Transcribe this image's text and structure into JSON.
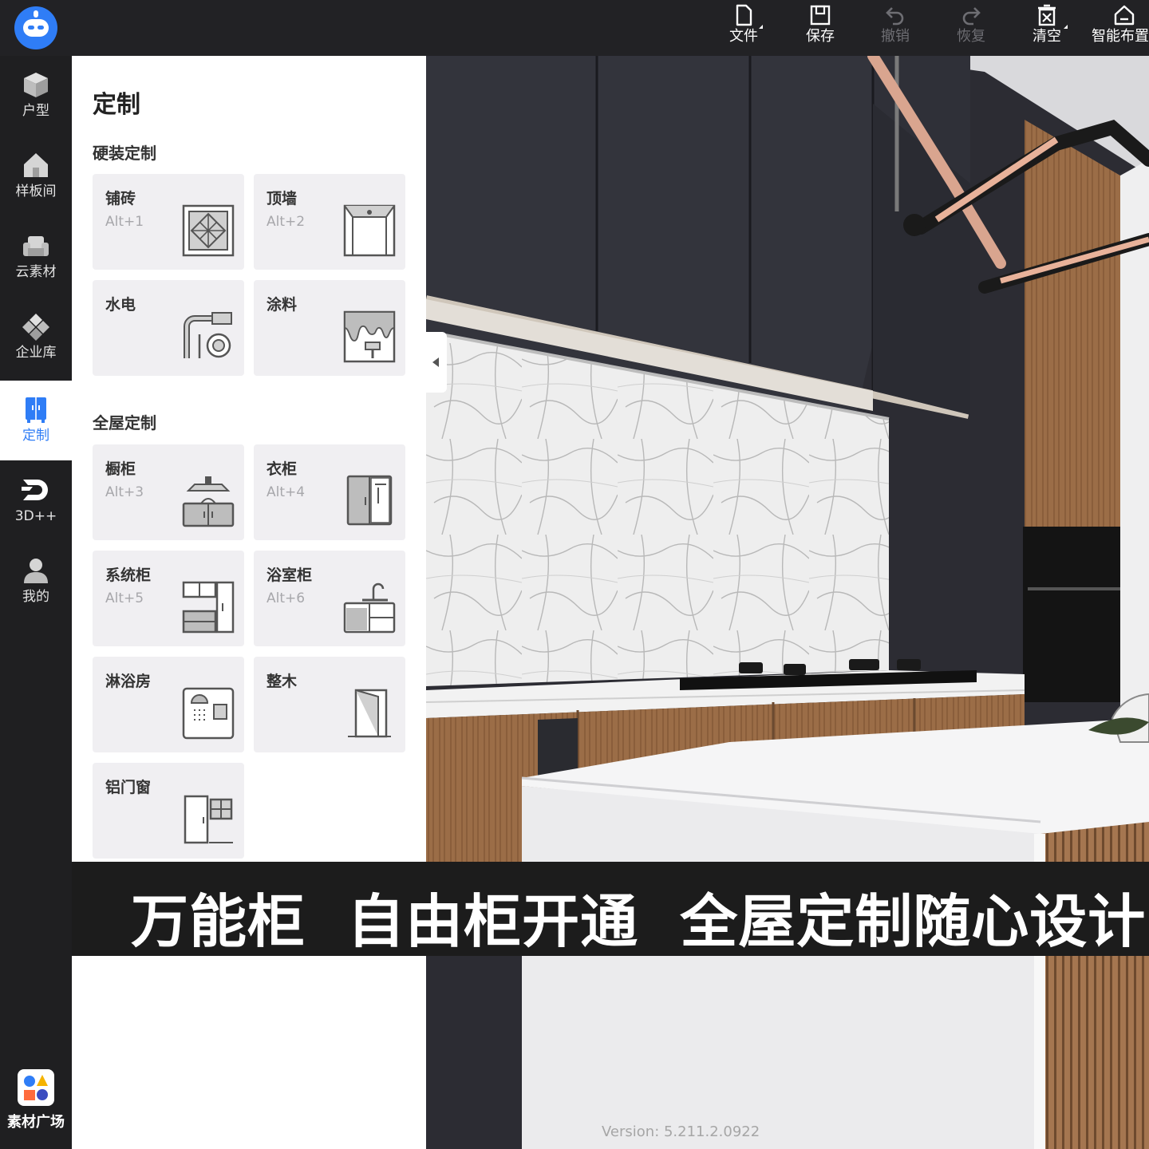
{
  "toolbar": {
    "file": "文件",
    "save": "保存",
    "undo": "撤销",
    "redo": "恢复",
    "clear": "清空",
    "smart_layout": "智能布置"
  },
  "nav": {
    "floorplan": "户型",
    "showroom": "样板间",
    "cloud_material": "云素材",
    "enterprise": "企业库",
    "custom": "定制",
    "three_d": "3D++",
    "mine": "我的",
    "material_square": "素材广场"
  },
  "panel": {
    "title": "定制",
    "hard_section": "硬装定制",
    "hard_items": [
      {
        "name": "铺砖",
        "key": "Alt+1",
        "icon": "tile-icon"
      },
      {
        "name": "顶墙",
        "key": "Alt+2",
        "icon": "ceiling-wall-icon"
      },
      {
        "name": "水电",
        "key": "",
        "icon": "plumbing-icon"
      },
      {
        "name": "涂料",
        "key": "",
        "icon": "paint-icon"
      }
    ],
    "whole_section": "全屋定制",
    "whole_items": [
      {
        "name": "橱柜",
        "key": "Alt+3",
        "icon": "kitchen-cabinet-icon"
      },
      {
        "name": "衣柜",
        "key": "Alt+4",
        "icon": "wardrobe-icon"
      },
      {
        "name": "系统柜",
        "key": "Alt+5",
        "icon": "system-cabinet-icon"
      },
      {
        "name": "浴室柜",
        "key": "Alt+6",
        "icon": "bathroom-cabinet-icon"
      },
      {
        "name": "淋浴房",
        "key": "",
        "icon": "shower-room-icon"
      },
      {
        "name": "整木",
        "key": "",
        "icon": "door-icon"
      },
      {
        "name": "铝门窗",
        "key": "",
        "icon": "aluminum-window-icon"
      }
    ]
  },
  "banner": {
    "text": "万能柜  自由柜开通  全屋定制随心设计"
  },
  "viewport": {
    "version": "Version: 5.211.2.0922"
  },
  "colors": {
    "accent": "#2f7df6",
    "toolbar_bg": "#222225",
    "panel_card_bg": "#f0eff2",
    "banner_bg": "#1c1c1c"
  }
}
